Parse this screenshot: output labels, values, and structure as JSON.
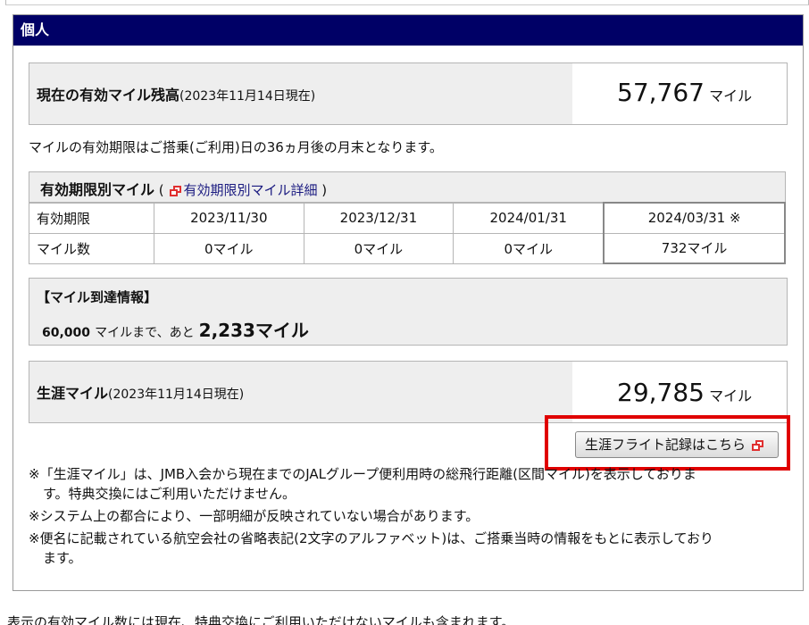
{
  "section": {
    "title": "個人"
  },
  "valid_miles": {
    "label": "現在の有効マイル残高",
    "date_note": "(2023年11月14日現在)",
    "value": "57,767",
    "unit": "マイル"
  },
  "expiry_note": "マイルの有効期限はご搭乗(ご利用)日の36ヵ月後の月末となります。",
  "expiry_table": {
    "title": "有効期限別マイル",
    "paren_open": "(",
    "link_text": "有効期限別マイル詳細",
    "paren_close": ")",
    "row_labels": [
      "有効期限",
      "マイル数"
    ],
    "dates": [
      "2023/11/30",
      "2023/12/31",
      "2024/01/31",
      "2024/03/31 ※"
    ],
    "miles": [
      "0マイル",
      "0マイル",
      "0マイル",
      "732マイル"
    ]
  },
  "arrival_info": {
    "title": "【マイル到達情報】",
    "target": "60,000",
    "text_mid": "マイルまで、あと",
    "remaining": "2,233マイル"
  },
  "lifetime_miles": {
    "label": "生涯マイル",
    "date_note": "(2023年11月14日現在)",
    "value": "29,785",
    "unit": "マイル"
  },
  "lifetime_button": {
    "label": "生涯フライト記録はこちら"
  },
  "notes": [
    "※「生涯マイル」は、JMB入会から現在までのJALグループ便利用時の総飛行距離(区間マイル)を表示しておりま",
    "す。特典交換にはご利用いただけません。",
    "※システム上の都合により、一部明細が反映されていない場合があります。",
    "※便名に記載されている航空会社の省略表記(2文字のアルファベット)は、ご搭乗当時の情報をもとに表示しており",
    "ます。"
  ],
  "footer_text": "表示の有効マイル数には現在、特典交換にご利用いただけないマイルも含まれます。",
  "colors": {
    "header_bg": "#000066",
    "highlight": "#e00000",
    "link": "#1a1a80"
  }
}
